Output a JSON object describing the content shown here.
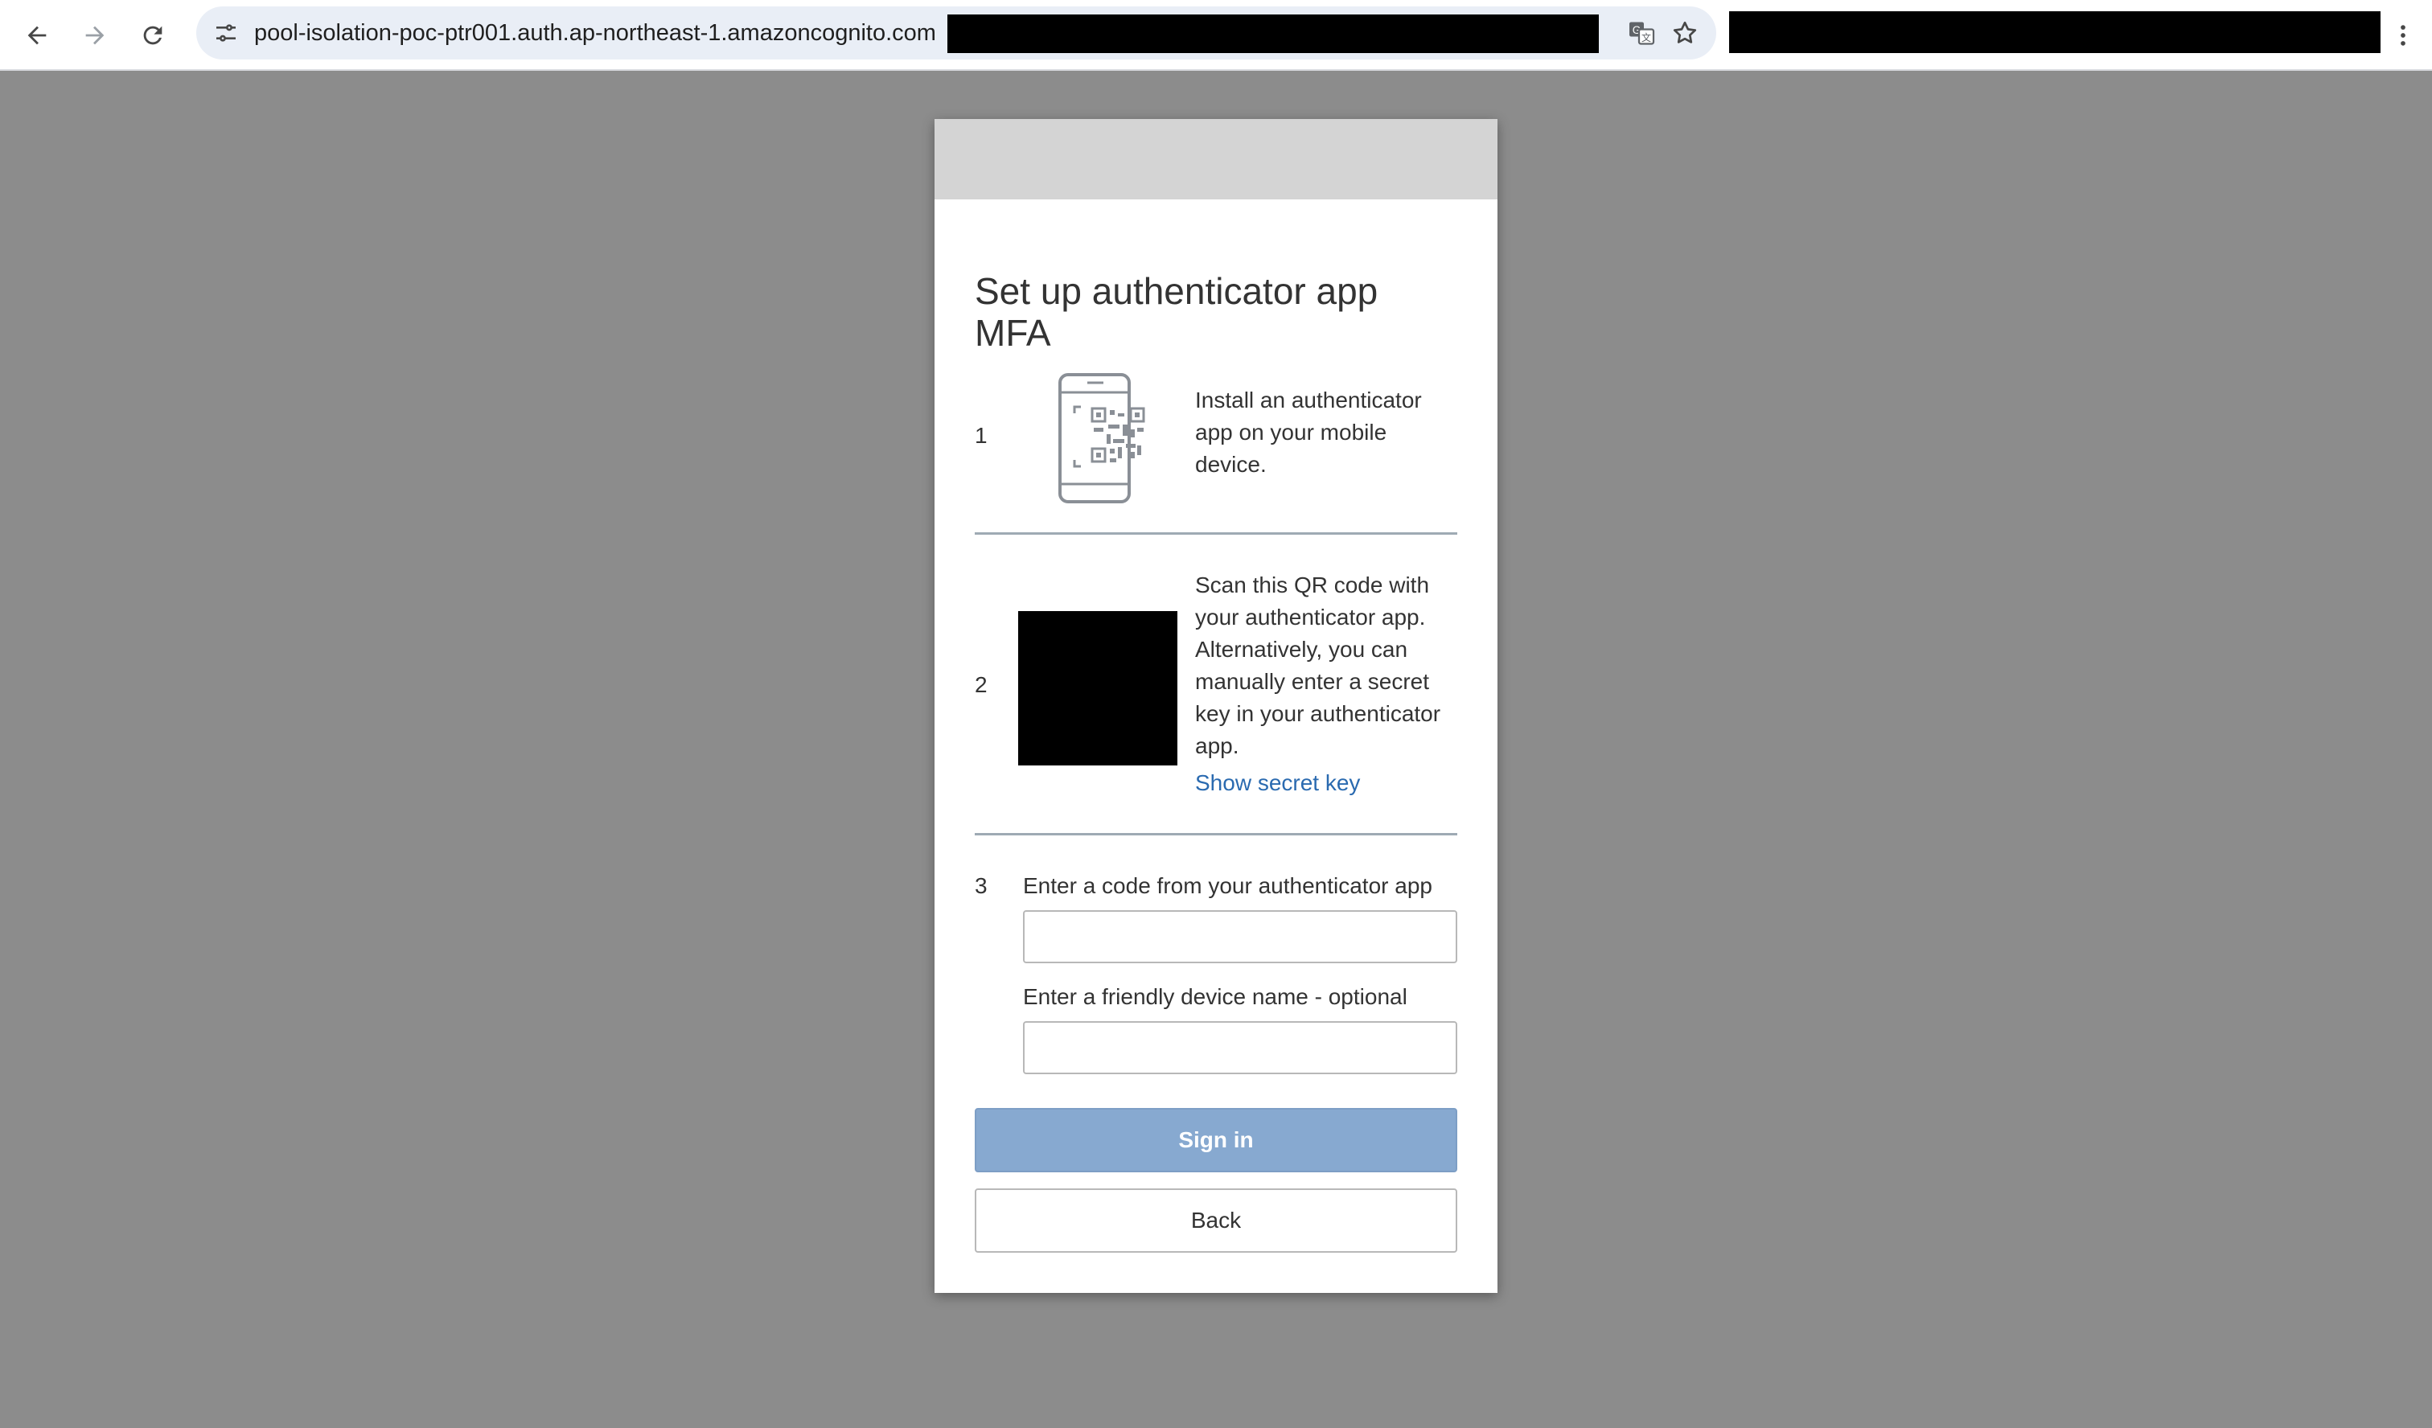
{
  "browser": {
    "url": "pool-isolation-poc-ptr001.auth.ap-northeast-1.amazoncognito.com",
    "icons": {
      "back": "arrow-left-icon",
      "forward": "arrow-right-icon",
      "reload": "reload-icon",
      "site_info": "tune-icon",
      "translate": "translate-icon",
      "bookmark": "star-icon",
      "menu": "kebab-menu-icon"
    }
  },
  "card": {
    "title": "Set up authenticator app MFA",
    "steps": [
      {
        "number": "1",
        "text": "Install an authenticator app on your mobile device.",
        "icon": "phone-qr-icon"
      },
      {
        "number": "2",
        "text": "Scan this QR code with your authenticator app. Alternatively, you can manually enter a secret key in your authenticator app.",
        "link": "Show secret key"
      },
      {
        "number": "3",
        "code_label": "Enter a code from your authenticator app",
        "code_value": "",
        "device_label": "Enter a friendly device name - optional",
        "device_value": ""
      }
    ],
    "sign_in_label": "Sign in",
    "back_label": "Back"
  },
  "colors": {
    "page_background": "#8c8c8c",
    "banner": "#d4d4d4",
    "primary_button": "#87a9d0",
    "link": "#2a6ab0"
  }
}
